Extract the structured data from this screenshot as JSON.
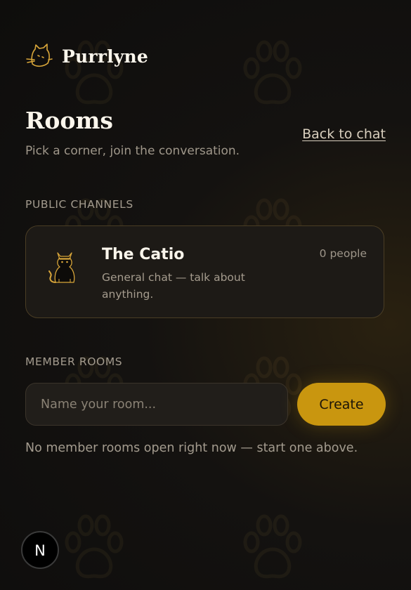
{
  "brand": {
    "name": "Purrlyne",
    "logo_icon": "cat-head-logo-icon"
  },
  "header": {
    "title": "Rooms",
    "subtitle": "Pick a corner, join the conversation.",
    "back_link": "Back to chat"
  },
  "public_channels": {
    "label": "PUBLIC CHANNELS",
    "rooms": [
      {
        "name": "The Catio",
        "description": "General chat — talk about anything.",
        "count": "0 people",
        "icon": "black-cat-icon"
      }
    ]
  },
  "member_rooms": {
    "label": "MEMBER ROOMS",
    "input_placeholder": "Name your room...",
    "create_label": "Create",
    "empty_text": "No member rooms open right now — start one above."
  },
  "badge": {
    "letter": "N",
    "icon": "nextjs-badge-icon"
  },
  "colors": {
    "accent": "#c9960f",
    "background": "#141210",
    "card_border": "#4a3d24",
    "text": "#fbf6ec",
    "muted": "#a39b8e"
  }
}
